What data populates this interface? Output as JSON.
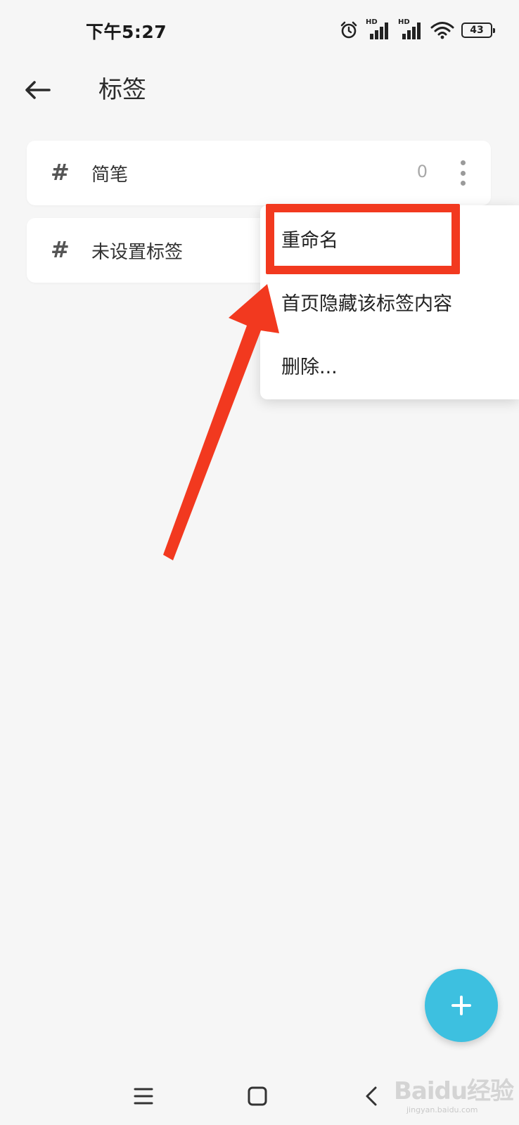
{
  "status_bar": {
    "time": "下午5:27",
    "network_label_1": "HD",
    "network_label_2": "HD",
    "battery": "43"
  },
  "header": {
    "title": "标签"
  },
  "tags": [
    {
      "name": "简笔",
      "count": "0"
    },
    {
      "name": "未设置标签",
      "count": ""
    }
  ],
  "menu": {
    "items": [
      "重命名",
      "首页隐藏该标签内容",
      "删除..."
    ]
  },
  "watermark": {
    "brand": "Baidu经验",
    "url": "jingyan.baidu.com"
  },
  "colors": {
    "annotation": "#f2391f",
    "fab": "#3dc0e0",
    "background": "#f6f6f6"
  }
}
